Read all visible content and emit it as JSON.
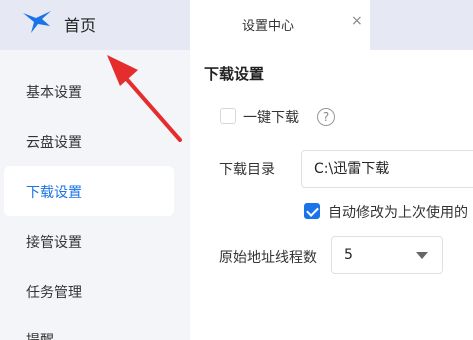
{
  "sidebar": {
    "home_label": "首页",
    "items": [
      {
        "label": "基本设置",
        "active": false
      },
      {
        "label": "云盘设置",
        "active": false
      },
      {
        "label": "下载设置",
        "active": true
      },
      {
        "label": "接管设置",
        "active": false
      },
      {
        "label": "任务管理",
        "active": false
      },
      {
        "label": "提醒",
        "active": false
      }
    ]
  },
  "tab": {
    "label": "设置中心",
    "close_glyph": "×"
  },
  "main": {
    "section_title": "下载设置",
    "one_click": {
      "label": "一键下载",
      "checked": false,
      "help_glyph": "?"
    },
    "download_dir": {
      "label": "下载目录",
      "value": "C:\\迅雷下载"
    },
    "auto_modify": {
      "label": "自动修改为上次使用的",
      "checked": true
    },
    "threads": {
      "label": "原始地址线程数",
      "value": "5"
    }
  },
  "colors": {
    "accent": "#1a73e8",
    "annotation_arrow": "#e52d2d"
  }
}
